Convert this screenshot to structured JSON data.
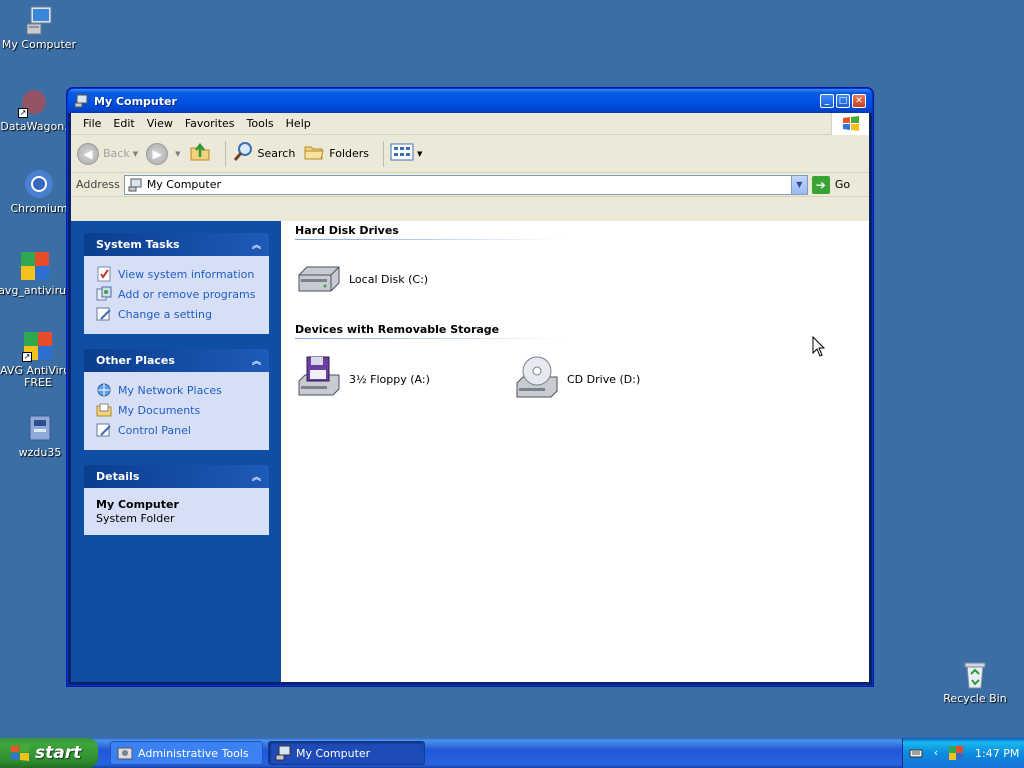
{
  "desktop": {
    "icons": [
      {
        "label": "My Computer"
      },
      {
        "label": "DataWagon."
      },
      {
        "label": "Chromium"
      },
      {
        "label": "avg_antivirus"
      },
      {
        "label": "AVG AntiVirus FREE"
      },
      {
        "label": "wzdu35"
      },
      {
        "label": "Recycle Bin"
      }
    ]
  },
  "window": {
    "title": "My Computer",
    "menu": [
      "File",
      "Edit",
      "View",
      "Favorites",
      "Tools",
      "Help"
    ],
    "toolbar": {
      "back_label": "Back",
      "search_label": "Search",
      "folders_label": "Folders"
    },
    "address": {
      "label": "Address",
      "value": "My Computer",
      "go_label": "Go"
    },
    "taskpane": {
      "system_tasks": {
        "title": "System Tasks",
        "links": [
          "View system information",
          "Add or remove programs",
          "Change a setting"
        ]
      },
      "other_places": {
        "title": "Other Places",
        "links": [
          "My Network Places",
          "My Documents",
          "Control Panel"
        ]
      },
      "details": {
        "title": "Details",
        "name": "My Computer",
        "type": "System Folder"
      }
    },
    "content": {
      "hard_disk_heading": "Hard Disk Drives",
      "local_disk": "Local Disk (C:)",
      "removable_heading": "Devices with Removable Storage",
      "floppy": "3½ Floppy (A:)",
      "cd": "CD Drive (D:)"
    }
  },
  "taskbar": {
    "start_label": "start",
    "tasks": [
      "Administrative Tools",
      "My Computer"
    ],
    "clock": "1:47 PM"
  },
  "colors": {
    "desktop": "#3a6ea5",
    "title_bar": "#0054e3",
    "taskpane": "#0f4fa3",
    "link": "#215dc6",
    "start_button": "#3ca63c"
  }
}
